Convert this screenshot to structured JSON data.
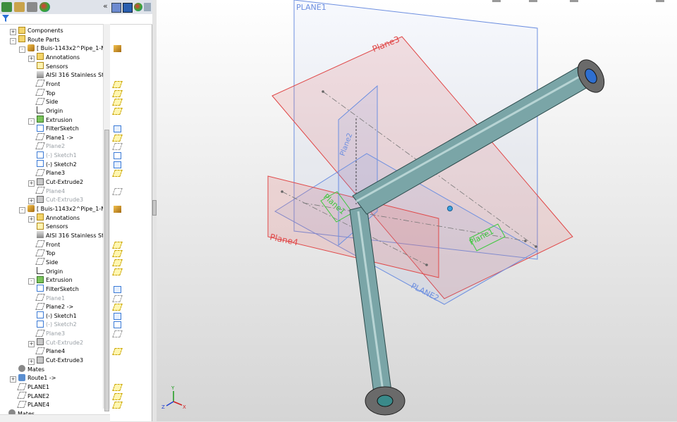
{
  "tabs": [
    "feature-manager",
    "property-manager",
    "configuration-manager",
    "display-manager"
  ],
  "collapse_glyph": "«",
  "tree": [
    {
      "label": "Components",
      "icon": "folder-icon",
      "indent": 0,
      "expander": "+",
      "dim": false
    },
    {
      "label": "Route Parts",
      "icon": "folder-icon",
      "indent": 0,
      "expander": "-",
      "dim": false
    },
    {
      "label": "[ Buis-1143x2^Pipe_1-Mi",
      "icon": "pipe-part-icon",
      "indent": 1,
      "expander": "-",
      "dim": false
    },
    {
      "label": "Annotations",
      "icon": "annotations-icon",
      "indent": 2,
      "expander": "+",
      "dim": false
    },
    {
      "label": "Sensors",
      "icon": "sensors-icon",
      "indent": 2,
      "expander": "",
      "dim": false
    },
    {
      "label": "AISI 316 Stainless Stee",
      "icon": "material-icon",
      "indent": 2,
      "expander": "",
      "dim": false
    },
    {
      "label": "Front",
      "icon": "plane-icon",
      "indent": 2,
      "expander": "",
      "dim": false
    },
    {
      "label": "Top",
      "icon": "plane-icon",
      "indent": 2,
      "expander": "",
      "dim": false
    },
    {
      "label": "Side",
      "icon": "plane-icon",
      "indent": 2,
      "expander": "",
      "dim": false
    },
    {
      "label": "Origin",
      "icon": "origin-icon",
      "indent": 2,
      "expander": "",
      "dim": false
    },
    {
      "label": "Extrusion",
      "icon": "extrusion-icon",
      "indent": 2,
      "expander": "-",
      "dim": false
    },
    {
      "label": "FilterSketch",
      "icon": "sketch-icon",
      "indent": 2,
      "expander": "",
      "dim": false
    },
    {
      "label": "Plane1 ->",
      "icon": "plane-icon",
      "indent": 2,
      "expander": "",
      "dim": false
    },
    {
      "label": "Plane2",
      "icon": "plane-icon",
      "indent": 2,
      "expander": "",
      "dim": true
    },
    {
      "label": "(-) Sketch1",
      "icon": "sketch-icon",
      "indent": 2,
      "expander": "",
      "dim": true
    },
    {
      "label": "(-) Sketch2",
      "icon": "sketch-icon",
      "indent": 2,
      "expander": "",
      "dim": false
    },
    {
      "label": "Plane3",
      "icon": "plane-icon",
      "indent": 2,
      "expander": "",
      "dim": false
    },
    {
      "label": "Cut-Extrude2",
      "icon": "cut-extrude-icon",
      "indent": 2,
      "expander": "+",
      "dim": false
    },
    {
      "label": "Plane4",
      "icon": "plane-icon",
      "indent": 2,
      "expander": "",
      "dim": true
    },
    {
      "label": "Cut-Extrude3",
      "icon": "cut-extrude-icon",
      "indent": 2,
      "expander": "+",
      "dim": true
    },
    {
      "label": "[ Buis-1143x2^Pipe_1-Mi",
      "icon": "pipe-part-icon",
      "indent": 1,
      "expander": "-",
      "dim": false
    },
    {
      "label": "Annotations",
      "icon": "annotations-icon",
      "indent": 2,
      "expander": "+",
      "dim": false
    },
    {
      "label": "Sensors",
      "icon": "sensors-icon",
      "indent": 2,
      "expander": "",
      "dim": false
    },
    {
      "label": "AISI 316 Stainless Stee",
      "icon": "material-icon",
      "indent": 2,
      "expander": "",
      "dim": false
    },
    {
      "label": "Front",
      "icon": "plane-icon",
      "indent": 2,
      "expander": "",
      "dim": false
    },
    {
      "label": "Top",
      "icon": "plane-icon",
      "indent": 2,
      "expander": "",
      "dim": false
    },
    {
      "label": "Side",
      "icon": "plane-icon",
      "indent": 2,
      "expander": "",
      "dim": false
    },
    {
      "label": "Origin",
      "icon": "origin-icon",
      "indent": 2,
      "expander": "",
      "dim": false
    },
    {
      "label": "Extrusion",
      "icon": "extrusion-icon",
      "indent": 2,
      "expander": "-",
      "dim": false
    },
    {
      "label": "FilterSketch",
      "icon": "sketch-icon",
      "indent": 2,
      "expander": "",
      "dim": false
    },
    {
      "label": "Plane1",
      "icon": "plane-icon",
      "indent": 2,
      "expander": "",
      "dim": true
    },
    {
      "label": "Plane2 ->",
      "icon": "plane-icon",
      "indent": 2,
      "expander": "",
      "dim": false
    },
    {
      "label": "(-) Sketch1",
      "icon": "sketch-icon",
      "indent": 2,
      "expander": "",
      "dim": false
    },
    {
      "label": "(-) Sketch2",
      "icon": "sketch-icon",
      "indent": 2,
      "expander": "",
      "dim": true
    },
    {
      "label": "Plane3",
      "icon": "plane-icon",
      "indent": 2,
      "expander": "",
      "dim": true
    },
    {
      "label": "Cut-Extrude2",
      "icon": "cut-extrude-icon",
      "indent": 2,
      "expander": "+",
      "dim": true
    },
    {
      "label": "Plane4",
      "icon": "plane-icon",
      "indent": 2,
      "expander": "",
      "dim": false
    },
    {
      "label": "Cut-Extrude3",
      "icon": "cut-extrude-icon",
      "indent": 2,
      "expander": "+",
      "dim": false
    },
    {
      "label": "Mates",
      "icon": "mates-icon",
      "indent": 0,
      "expander": "",
      "dim": false
    },
    {
      "label": "Route1 ->",
      "icon": "route-icon",
      "indent": 0,
      "expander": "+",
      "dim": false
    },
    {
      "label": "PLANE1",
      "icon": "plane-icon",
      "indent": 0,
      "expander": "",
      "dim": false
    },
    {
      "label": "PLANE2",
      "icon": "plane-icon",
      "indent": 0,
      "expander": "",
      "dim": false
    },
    {
      "label": "PLANE4",
      "icon": "plane-icon",
      "indent": 0,
      "expander": "",
      "dim": false
    },
    {
      "label": "Mates",
      "icon": "mates-icon",
      "indent": -1,
      "expander": "",
      "dim": false
    }
  ],
  "viewport": {
    "plane_labels": {
      "plane1": "PLANE1",
      "plane3": "Plane3",
      "plane4": "Plane4",
      "plane2": "PLANE2",
      "sketch_plane1": "Plane1",
      "sketch_plane2": "Plane2",
      "sketch_plane1b": "Plane1",
      "sketch_plane2b": "PLANE2"
    },
    "triad_labels": {
      "y": "Y",
      "x": "X",
      "z": "Z"
    }
  },
  "colors": {
    "plane_blue": "#6d8fe0",
    "plane_red": "#e04848",
    "sketch_green": "#3cc83c",
    "pipe": "#6f9a9c",
    "flange": "#6a6a6a"
  }
}
